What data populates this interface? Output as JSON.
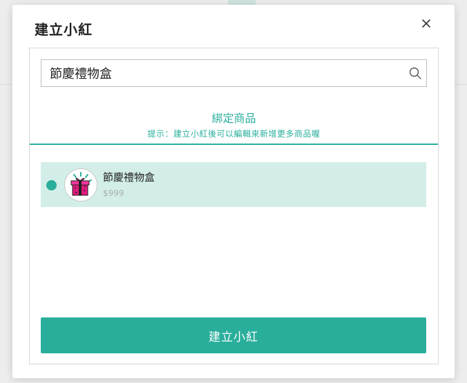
{
  "modal": {
    "title": "建立小紅",
    "close_icon": "close-icon"
  },
  "search": {
    "value": "節慶禮物盒",
    "icon": "search-icon"
  },
  "section": {
    "title": "綁定商品",
    "hint": "提示：建立小紅後可以編輯來新增更多商品喔"
  },
  "products": [
    {
      "name": "節慶禮物盒",
      "price": "$999",
      "selected": true,
      "thumbnail_icon": "gift-box-icon"
    }
  ],
  "actions": {
    "submit_label": "建立小紅"
  },
  "colors": {
    "accent": "#2aae9c",
    "selected_row": "#d3eee8",
    "gift_box": "#e0197d"
  }
}
